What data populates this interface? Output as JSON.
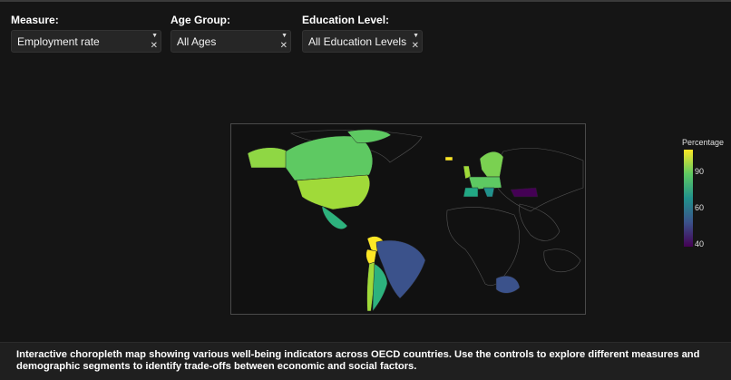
{
  "controls": {
    "measure": {
      "label": "Measure:",
      "value": "Employment rate"
    },
    "age_group": {
      "label": "Age Group:",
      "value": "All Ages"
    },
    "education": {
      "label": "Education Level:",
      "value": "All Education Levels"
    }
  },
  "icons": {
    "dropdown_arrow": "caret-down-icon",
    "clear": "clear-icon"
  },
  "legend": {
    "title": "Percentage",
    "ticks": [
      "90",
      "60",
      "40"
    ],
    "colorscale": [
      "#fde725",
      "#5ec962",
      "#21918c",
      "#3b528b",
      "#440154"
    ]
  },
  "footer": {
    "description": "Interactive choropleth map showing various well-being indicators across OECD countries. Use the controls to explore different measures and demographic segments to identify trade-offs between economic and social factors."
  },
  "colors": {
    "background": "#151515",
    "panel": "#262626",
    "map_border": "#4a4a4a"
  }
}
